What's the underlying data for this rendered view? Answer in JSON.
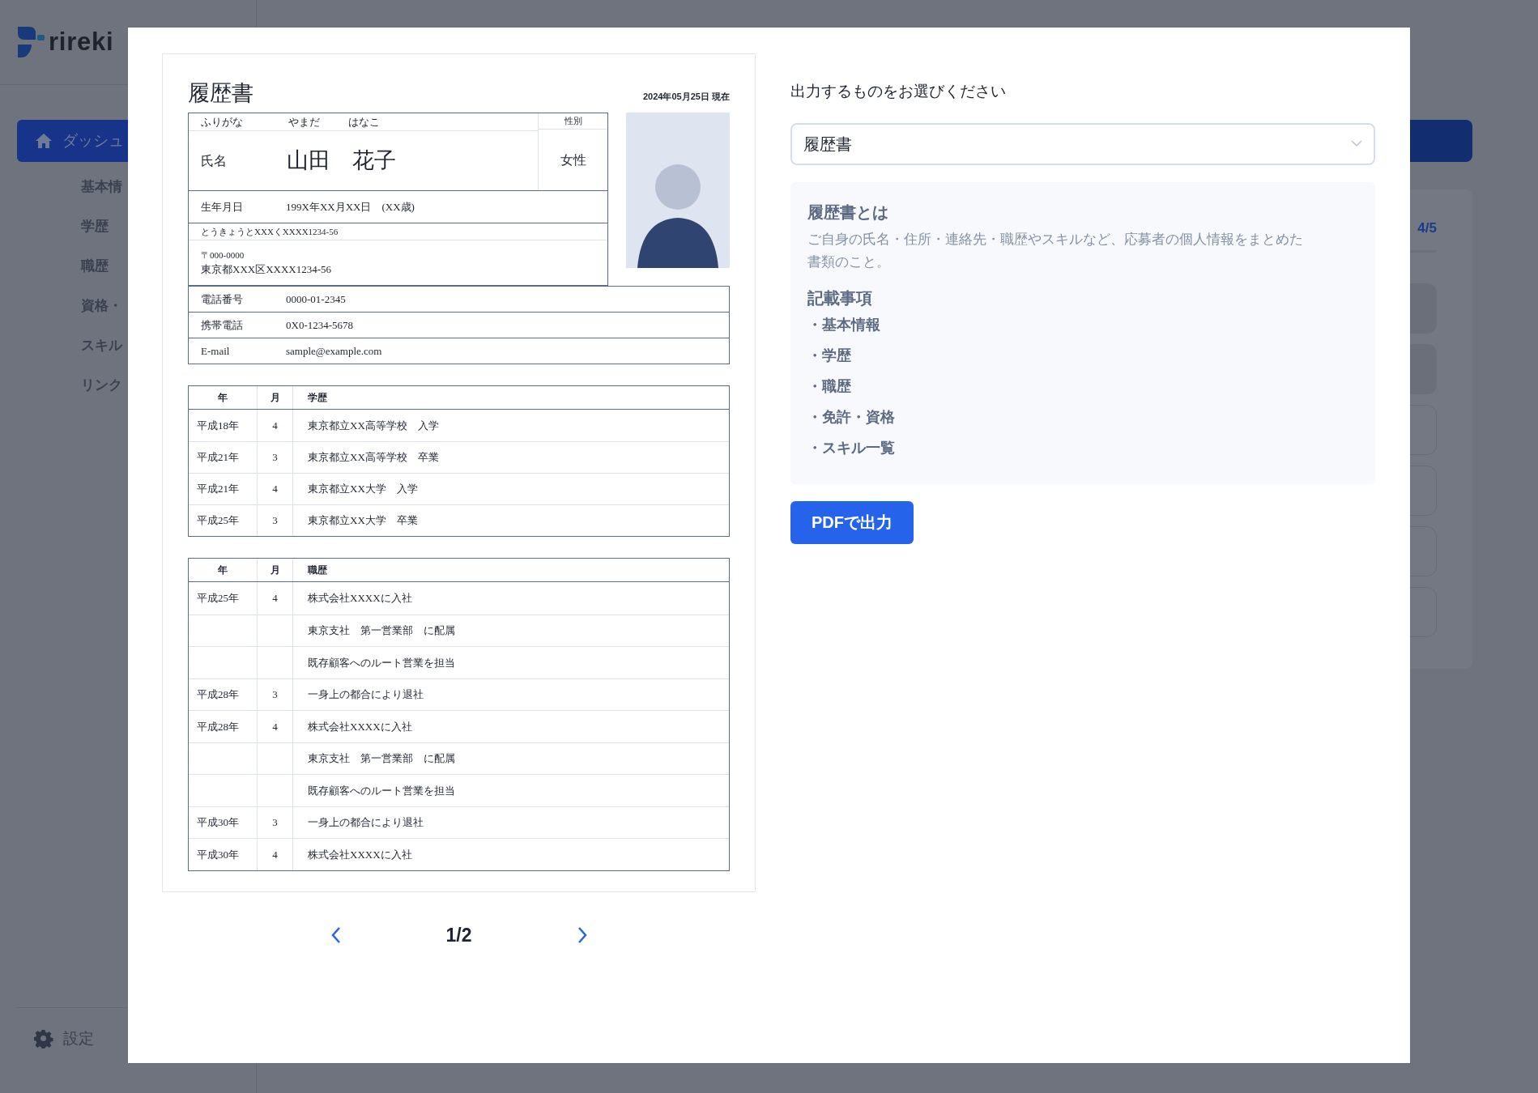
{
  "app": {
    "logo": "rireki"
  },
  "sidebar": {
    "items": [
      {
        "label": "ダッシュ",
        "kind": "main",
        "selected": true
      },
      {
        "label": "基本情",
        "kind": "sub",
        "selected": false
      },
      {
        "label": "学歴",
        "kind": "sub",
        "selected": false
      },
      {
        "label": "職歴",
        "kind": "sub",
        "selected": false
      },
      {
        "label": "資格・",
        "kind": "sub",
        "selected": false
      },
      {
        "label": "スキル",
        "kind": "sub",
        "selected": false
      },
      {
        "label": "リンク",
        "kind": "sub",
        "selected": false
      }
    ],
    "settings": "設定"
  },
  "main": {
    "progress": "4/5"
  },
  "modal": {
    "preview": {
      "title": "履歴書",
      "date": "2024年05月25日 現在",
      "furigana_label": "ふりがな",
      "furigana_family": "やまだ",
      "furigana_given": "はなこ",
      "gender_label": "性別",
      "name_label": "氏名",
      "name": "山田　花子",
      "gender": "女性",
      "birth_label": "生年月日",
      "birth": "199X年XX月XX日　(XX歳)",
      "address_kana": "とうきょうとXXXくXXXX1234-56",
      "postal": "〒000-0000",
      "address": "東京都XXX区XXXX1234-56",
      "contacts": [
        {
          "label": "電話番号",
          "value": "0000-01-2345"
        },
        {
          "label": "携帯電話",
          "value": "0X0-1234-5678"
        },
        {
          "label": "E-mail",
          "value": "sample@example.com"
        }
      ],
      "education": {
        "columns": [
          "年",
          "月",
          "学歴"
        ],
        "rows": [
          {
            "year": "平成18年",
            "month": "4",
            "text": "東京都立XX高等学校　入学"
          },
          {
            "year": "平成21年",
            "month": "3",
            "text": "東京都立XX高等学校　卒業"
          },
          {
            "year": "平成21年",
            "month": "4",
            "text": "東京都立XX大学　入学"
          },
          {
            "year": "平成25年",
            "month": "3",
            "text": "東京都立XX大学　卒業"
          }
        ]
      },
      "work": {
        "columns": [
          "年",
          "月",
          "職歴"
        ],
        "rows": [
          {
            "year": "平成25年",
            "month": "4",
            "text": "株式会社XXXXに入社"
          },
          {
            "text": "東京支社　第一営業部　に配属"
          },
          {
            "text": "既存顧客へのルート営業を担当"
          },
          {
            "year": "平成28年",
            "month": "3",
            "text": "一身上の都合により退社"
          },
          {
            "year": "平成28年",
            "month": "4",
            "text": "株式会社XXXXに入社"
          },
          {
            "text": "東京支社　第一営業部　に配属"
          },
          {
            "text": "既存顧客へのルート営業を担当"
          },
          {
            "year": "平成30年",
            "month": "3",
            "text": "一身上の都合により退社"
          },
          {
            "year": "平成30年",
            "month": "4",
            "text": "株式会社XXXXに入社"
          }
        ]
      }
    },
    "pagination": {
      "page": "1/2"
    },
    "output": {
      "label": "出力するものをお選びください",
      "select_value": "履歴書",
      "info_title": "履歴書とは",
      "info_text": "ご自身の氏名・住所・連絡先・職歴やスキルなど、応募者の個人情報をまとめた書類のこと。",
      "items_title": "記載事項",
      "items": [
        "・基本情報",
        "・学歴",
        "・職歴",
        "・免許・資格",
        "・スキル一覧"
      ],
      "button": "PDFで出力"
    }
  }
}
